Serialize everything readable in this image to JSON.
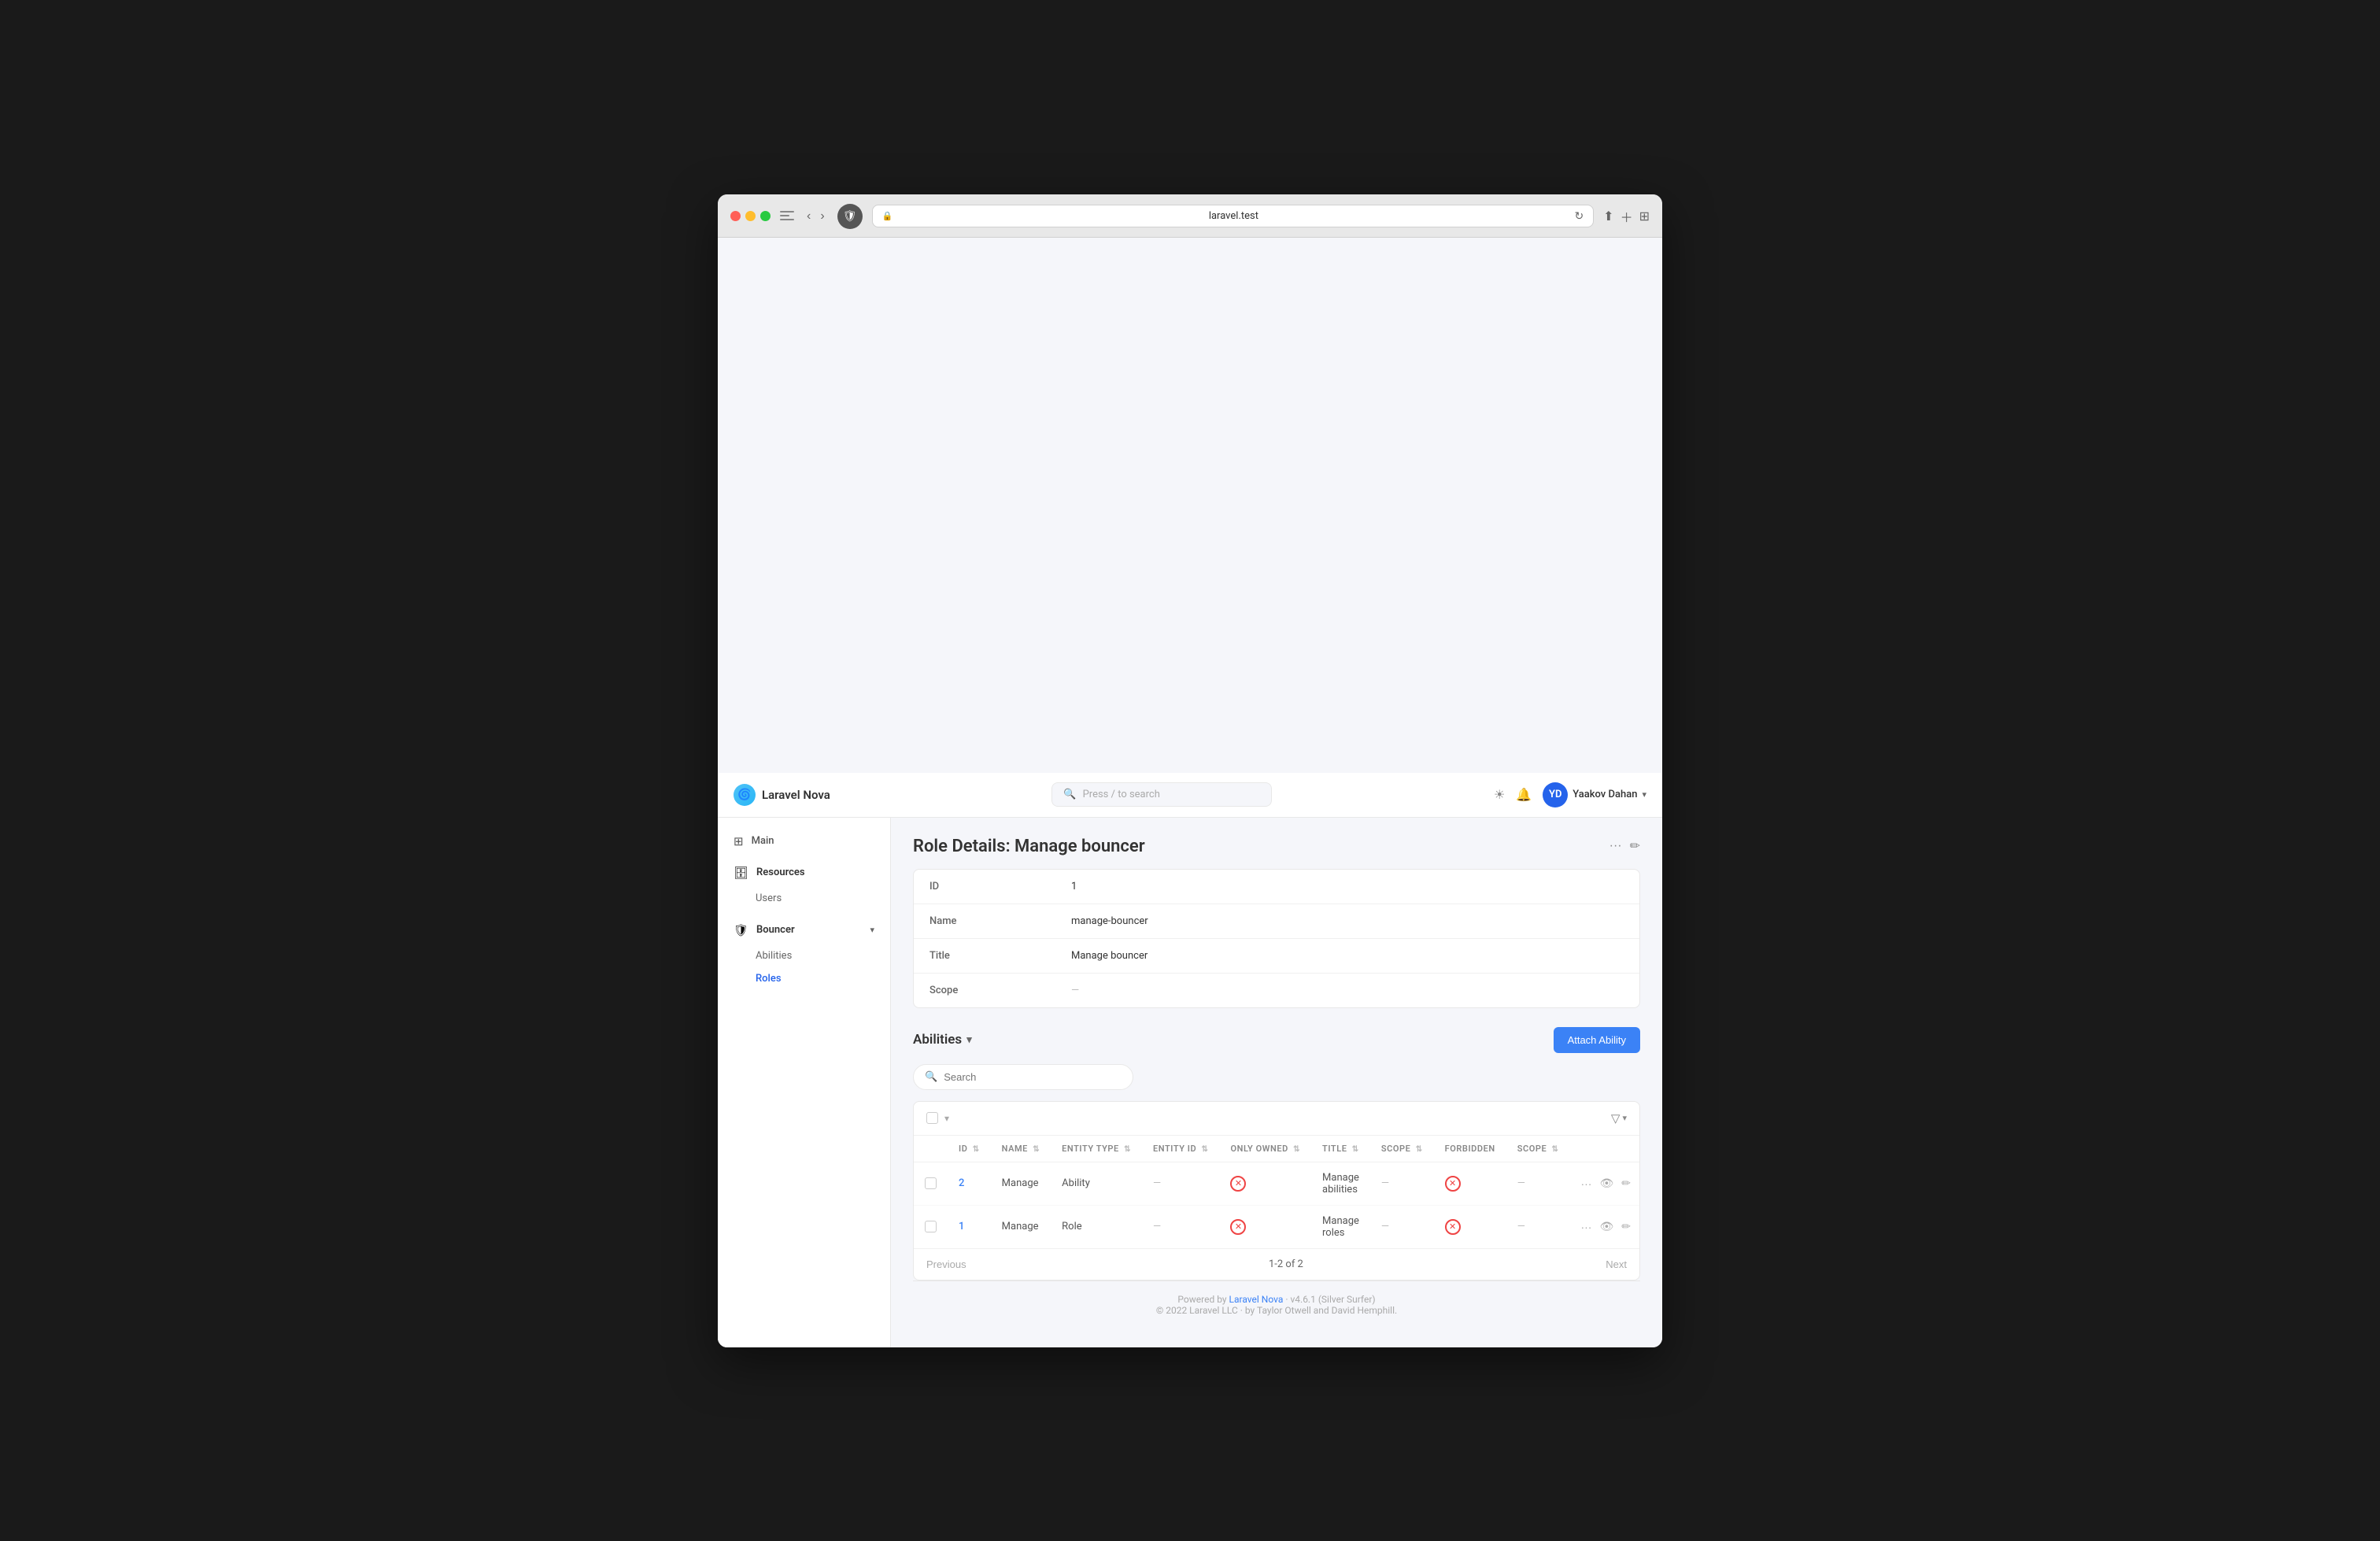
{
  "browser": {
    "url": "laravel.test",
    "traffic_lights": [
      "red",
      "yellow",
      "green"
    ]
  },
  "header": {
    "logo_text": "🌀",
    "title": "Laravel Nova",
    "search_placeholder": "Press / to search",
    "user_name": "Yaakov Dahan",
    "user_initials": "YD"
  },
  "sidebar": {
    "main_label": "Main",
    "resources_label": "Resources",
    "users_label": "Users",
    "bouncer_label": "Bouncer",
    "abilities_label": "Abilities",
    "roles_label": "Roles"
  },
  "page": {
    "title": "Role Details: Manage bouncer",
    "detail_fields": [
      {
        "label": "ID",
        "value": "1"
      },
      {
        "label": "Name",
        "value": "manage-bouncer"
      },
      {
        "label": "Title",
        "value": "Manage bouncer"
      },
      {
        "label": "Scope",
        "value": "—"
      }
    ]
  },
  "abilities": {
    "section_title": "Abilities",
    "search_placeholder": "Search",
    "attach_button": "Attach Ability",
    "columns": [
      {
        "label": "ID"
      },
      {
        "label": "NAME"
      },
      {
        "label": "ENTITY TYPE"
      },
      {
        "label": "ENTITY ID"
      },
      {
        "label": "ONLY OWNED"
      },
      {
        "label": "TITLE"
      },
      {
        "label": "SCOPE"
      },
      {
        "label": "FORBIDDEN"
      },
      {
        "label": "SCOPE"
      }
    ],
    "rows": [
      {
        "id": "2",
        "name": "Manage",
        "entity_type": "Ability",
        "entity_id": "—",
        "only_owned": "forbidden",
        "title": "Manage abilities",
        "scope": "—",
        "forbidden": "forbidden",
        "scope2": "—"
      },
      {
        "id": "1",
        "name": "Manage",
        "entity_type": "Role",
        "entity_id": "—",
        "only_owned": "forbidden",
        "title": "Manage roles",
        "scope": "—",
        "forbidden": "forbidden",
        "scope2": "—"
      }
    ],
    "pagination": {
      "previous": "Previous",
      "next": "Next",
      "info": "1-2 of 2"
    }
  },
  "footer": {
    "powered_by": "Powered by",
    "nova_link": "Laravel Nova",
    "version": "· v4.6.1 (Silver Surfer)",
    "copyright": "© 2022 Laravel LLC · by Taylor Otwell and David Hemphill."
  }
}
